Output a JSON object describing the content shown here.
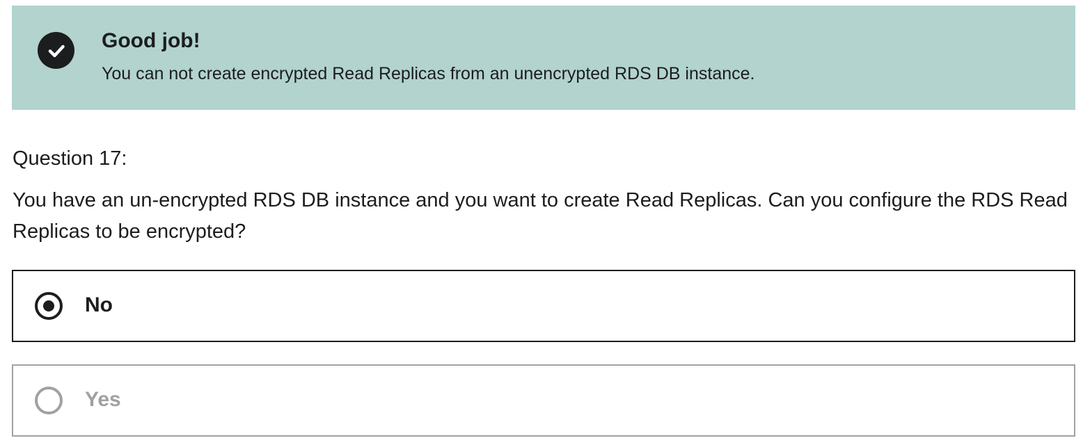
{
  "result_alert": {
    "icon": "check-circle-icon",
    "title": "Good job!",
    "message": "You can not create encrypted Read Replicas from an unencrypted RDS DB instance.",
    "background_color": "#b2d3ce"
  },
  "question": {
    "number_label": "Question 17:",
    "text": "You have an un-encrypted RDS DB instance and you want to create Read Replicas. Can you configure the RDS Read Replicas to be encrypted?"
  },
  "answers": [
    {
      "label": "No",
      "selected": true
    },
    {
      "label": "Yes",
      "selected": false
    }
  ]
}
